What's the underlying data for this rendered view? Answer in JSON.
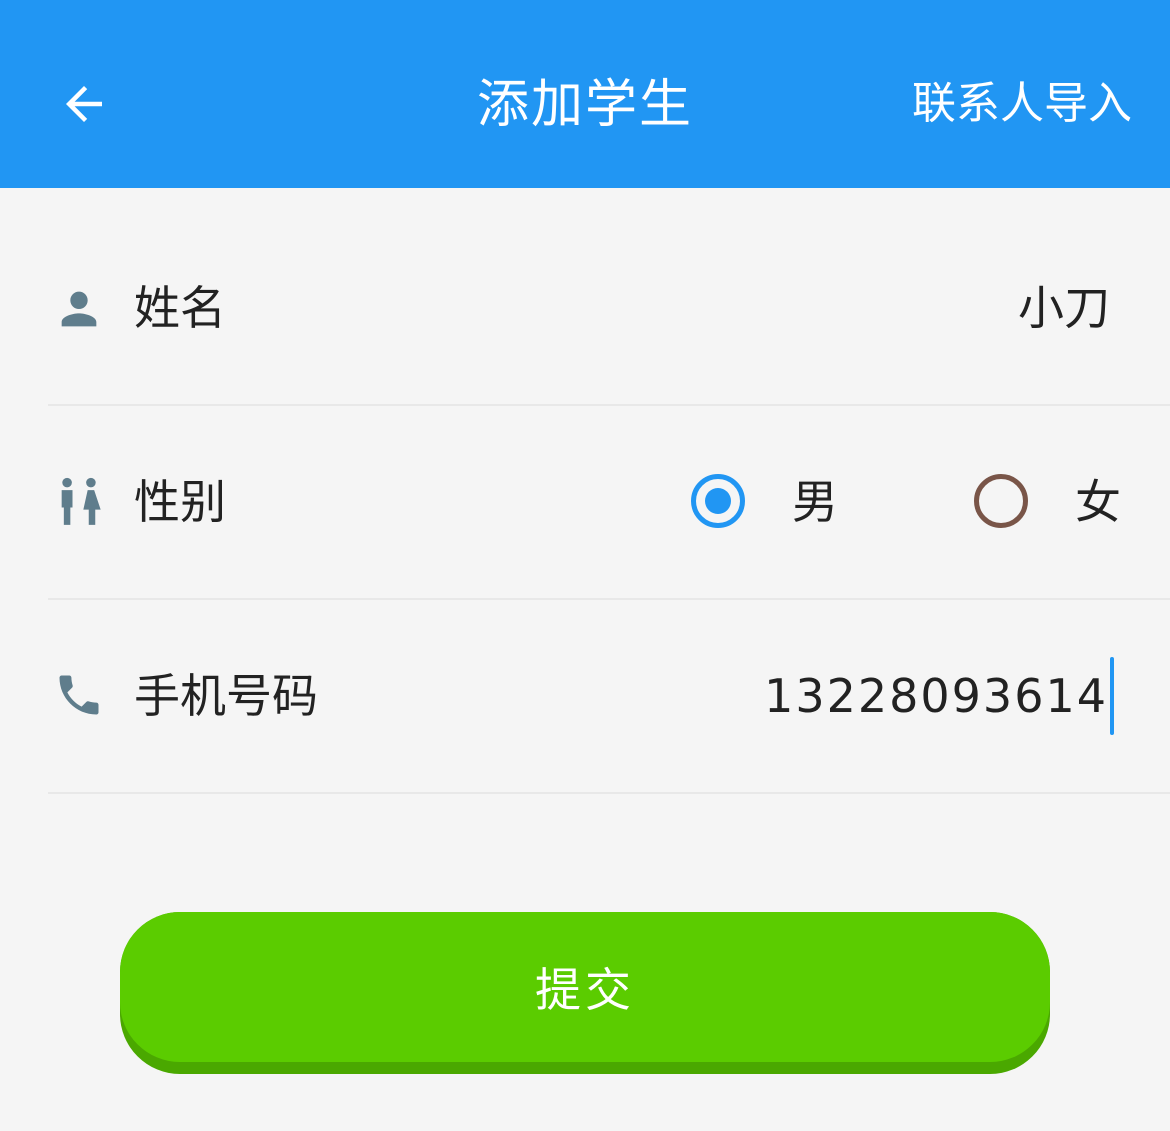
{
  "appbar": {
    "title": "添加学生",
    "import_label": "联系人导入",
    "background": "#2196f3",
    "back_icon": "arrow-left-icon"
  },
  "form": {
    "name": {
      "icon": "person-icon",
      "label": "姓名",
      "value": "小刀"
    },
    "gender": {
      "icon": "people-icon",
      "label": "性别",
      "options": [
        {
          "label": "男",
          "selected": true
        },
        {
          "label": "女",
          "selected": false
        }
      ]
    },
    "phone": {
      "icon": "phone-icon",
      "label": "手机号码",
      "value": "13228093614"
    }
  },
  "submit": {
    "label": "提交",
    "color": "#5bcc00"
  }
}
